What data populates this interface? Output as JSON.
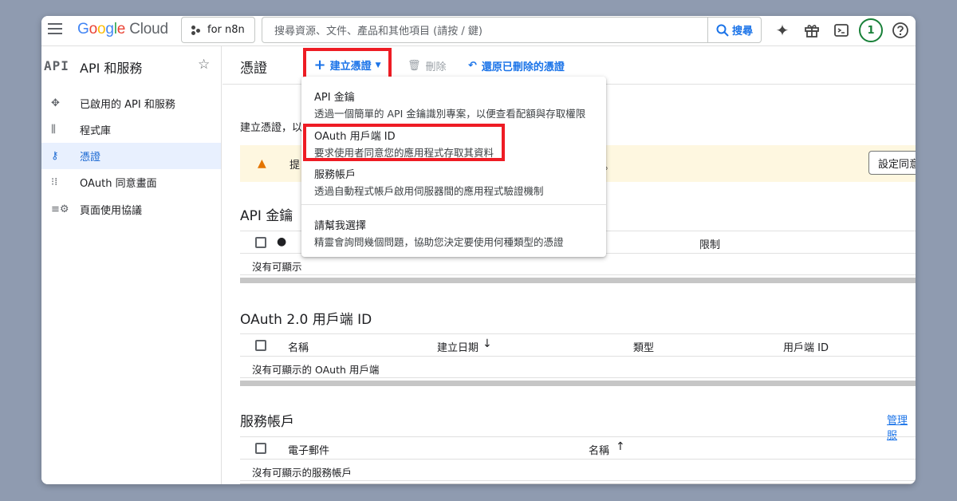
{
  "brand": {
    "logo_text_google": [
      "G",
      "o",
      "o",
      "g",
      "l",
      "e"
    ],
    "logo_text_cloud": "Cloud"
  },
  "topbar": {
    "project": "for n8n",
    "search_placeholder": "搜尋資源、文件、產品和其他項目 (請按 / 鍵)",
    "search_button": "搜尋",
    "notification_count": "1"
  },
  "sidebar": {
    "logo": "API",
    "title": "API 和服務",
    "items": [
      {
        "label": "已啟用的 API 和服務",
        "icon": "diamond-arrows-icon"
      },
      {
        "label": "程式庫",
        "icon": "library-icon"
      },
      {
        "label": "憑證",
        "icon": "key-icon",
        "active": true
      },
      {
        "label": "OAuth 同意畫面",
        "icon": "consent-icon"
      },
      {
        "label": "頁面使用協議",
        "icon": "settings-list-icon"
      }
    ]
  },
  "main": {
    "title": "憑證",
    "create_button": "建立憑證",
    "delete_button": "刪除",
    "restore_button": "還原已刪除的憑證",
    "intro": "建立憑證，以",
    "warning_prefix": "提",
    "warning_suffix": "。",
    "config_button": "設定同意",
    "api_keys": {
      "title": "API 金鑰",
      "col_restrict": "限制",
      "empty": "沒有可顯示"
    },
    "oauth": {
      "title": "OAuth 2.0 用戶端 ID",
      "cols": [
        "名稱",
        "建立日期",
        "類型",
        "用戶端 ID"
      ],
      "empty": "沒有可顯示的 OAuth 用戶端"
    },
    "service_accounts": {
      "title": "服務帳戶",
      "manage_link": "管理服",
      "cols": [
        "電子郵件",
        "名稱"
      ],
      "empty": "沒有可顯示的服務帳戶"
    }
  },
  "dropdown": {
    "items": [
      {
        "title": "API 金鑰",
        "desc": "透過一個簡單的 API 金鑰識別專案，以便查看配額與存取權限"
      },
      {
        "title": "OAuth 用戶端 ID",
        "desc": "要求使用者同意您的應用程式存取其資料"
      },
      {
        "title": "服務帳戶",
        "desc": "透過自動程式帳戶啟用伺服器間的應用程式驗證機制"
      },
      {
        "title": "請幫我選擇",
        "desc": "精靈會詢問幾個問題，協助您決定要使用何種類型的憑證"
      }
    ]
  },
  "colors": {
    "accent": "#1a73e8",
    "highlight": "#ee1c24",
    "warning_bg": "#fef7e0"
  }
}
